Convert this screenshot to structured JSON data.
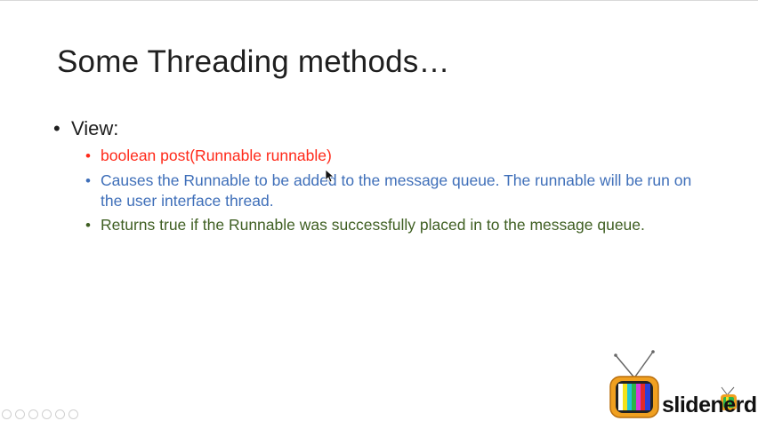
{
  "slide": {
    "title": "Some Threading methods…",
    "level1": {
      "bullet": "•",
      "label": "View:"
    },
    "points": [
      {
        "bullet": "•",
        "text": "boolean post(Runnable runnable)",
        "color": "#ff2a1a"
      },
      {
        "bullet": "•",
        "text": "Causes the Runnable to be added to the message queue. The runnable will be run on the user interface thread.",
        "color": "#3f6fb9"
      },
      {
        "bullet": "•",
        "text": "Returns true if the Runnable was successfully placed in to the message queue.",
        "color": "#3f5f22"
      }
    ]
  },
  "branding": {
    "logo_text": "slidenerd",
    "icon": "retro-tv-icon"
  }
}
